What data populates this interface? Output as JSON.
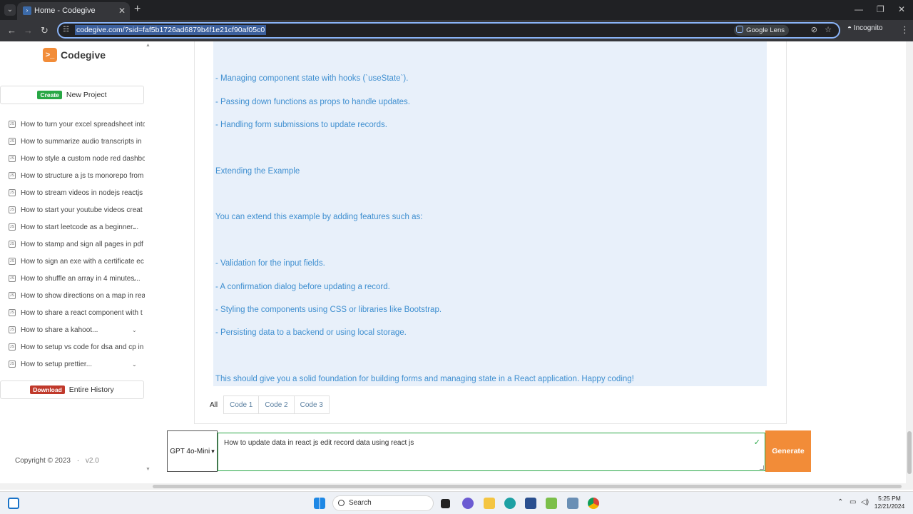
{
  "browser": {
    "tab_title": "Home - Codegive",
    "url": "codegive.com/?sid=faf5b1726ad6879b4f1e21cf90af05c0",
    "lens_label": "Google Lens",
    "incognito_label": "Incognito"
  },
  "sidebar": {
    "logo": "Codegive",
    "create_badge": "Create",
    "create_label": "New Project",
    "history": [
      {
        "label": "How to turn your excel spreadsheet into",
        "chevron": false
      },
      {
        "label": "How to summarize audio transcripts in",
        "chevron": false
      },
      {
        "label": "How to style a custom node red dashbo",
        "chevron": false
      },
      {
        "label": "How to structure a js ts monorepo from",
        "chevron": false
      },
      {
        "label": "How to stream videos in nodejs reactjs",
        "chevron": false
      },
      {
        "label": "How to start your youtube videos creat",
        "chevron": false
      },
      {
        "label": "How to start leetcode as a beginner...",
        "chevron": true
      },
      {
        "label": "How to stamp and sign all pages in pdf",
        "chevron": false
      },
      {
        "label": "How to sign an exe with a certificate ec",
        "chevron": false
      },
      {
        "label": "How to shuffle an array in 4 minutes...",
        "chevron": true
      },
      {
        "label": "How to show directions on a map in rea",
        "chevron": false
      },
      {
        "label": "How to share a react component with t",
        "chevron": false
      },
      {
        "label": "How to share a kahoot...",
        "chevron": true
      },
      {
        "label": "How to setup vs code for dsa and cp in",
        "chevron": false
      },
      {
        "label": "How to setup prettier...",
        "chevron": true
      }
    ],
    "download_badge": "Download",
    "download_label": "Entire History",
    "copyright": "Copyright © 2023",
    "version": "v2.0"
  },
  "answer": {
    "lines": [
      "- Managing component state with hooks (`useState`).",
      "- Passing down functions as props to handle updates.",
      "- Handling form submissions to update records.",
      "Extending the Example",
      "You can extend this example by adding features such as:",
      "- Validation for the input fields.",
      "- A confirmation dialog before updating a record.",
      "- Styling the components using CSS or libraries like Bootstrap.",
      "- Persisting data to a backend or using local storage.",
      "This should give you a solid foundation for building forms and managing state in a React application. Happy coding!"
    ]
  },
  "tabs": [
    "All",
    "Code 1",
    "Code 2",
    "Code 3"
  ],
  "input": {
    "model": "GPT 4o-Mini",
    "prompt": "How to update data in react js edit record data using react js",
    "generate_label": "Generate"
  },
  "taskbar": {
    "search_label": "Search",
    "time": "5:25 PM",
    "date": "12/21/2024"
  },
  "colors": {
    "accent_orange": "#f28c38",
    "answer_bg": "#e8f0fa",
    "answer_text": "#3f8fd0",
    "create_green": "#28a745",
    "download_red": "#c0392b"
  }
}
